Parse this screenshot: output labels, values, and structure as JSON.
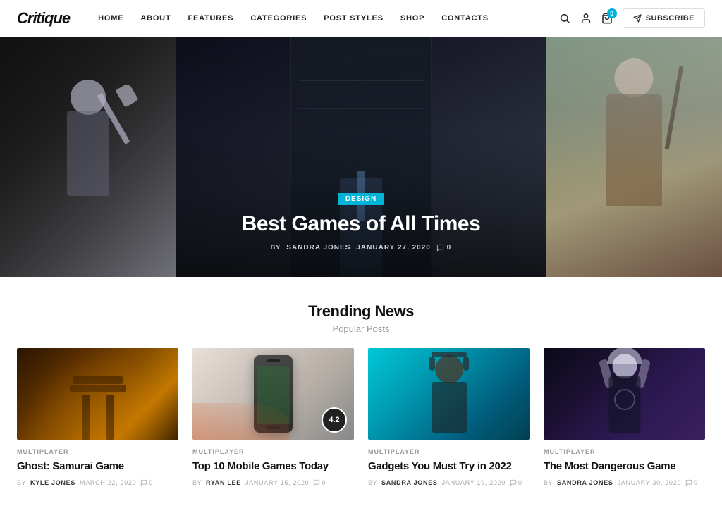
{
  "logo": {
    "text": "Critique"
  },
  "nav": {
    "items": [
      {
        "label": "Home",
        "id": "home"
      },
      {
        "label": "About",
        "id": "about"
      },
      {
        "label": "Features",
        "id": "features"
      },
      {
        "label": "Categories",
        "id": "categories"
      },
      {
        "label": "Post Styles",
        "id": "post-styles"
      },
      {
        "label": "Shop",
        "id": "shop"
      },
      {
        "label": "Contacts",
        "id": "contacts"
      }
    ]
  },
  "header": {
    "cart_count": "0",
    "subscribe_label": "Subscribe"
  },
  "hero": {
    "category_badge": "Design",
    "title": "Best Games of All Times",
    "author_prefix": "By",
    "author": "Sandra Jones",
    "date": "January 27, 2020",
    "comment_count": "0"
  },
  "trending": {
    "title": "Trending News",
    "subtitle": "Popular Posts"
  },
  "cards": [
    {
      "id": "card-1",
      "category": "Multiplayer",
      "title": "Ghost: Samurai Game",
      "author": "Kyle Jones",
      "date": "March 22, 2020",
      "comments": "0",
      "img_class": "img-samurai",
      "has_rating": false
    },
    {
      "id": "card-2",
      "category": "Multiplayer",
      "title": "Top 10 Mobile Games Today",
      "author": "Ryan Lee",
      "date": "January 15, 2020",
      "comments": "0",
      "img_class": "img-mobile",
      "has_rating": true,
      "rating": "4.2"
    },
    {
      "id": "card-3",
      "category": "Multiplayer",
      "title": "Gadgets You Must Try in 2022",
      "author": "Sandra Jones",
      "date": "January 19, 2020",
      "comments": "0",
      "img_class": "img-gadget",
      "has_rating": false
    },
    {
      "id": "card-4",
      "category": "Multiplayer",
      "title": "The Most Dangerous Game",
      "author": "Sandra Jones",
      "date": "January 30, 2020",
      "comments": "0",
      "img_class": "img-dangerous",
      "has_rating": false
    }
  ]
}
